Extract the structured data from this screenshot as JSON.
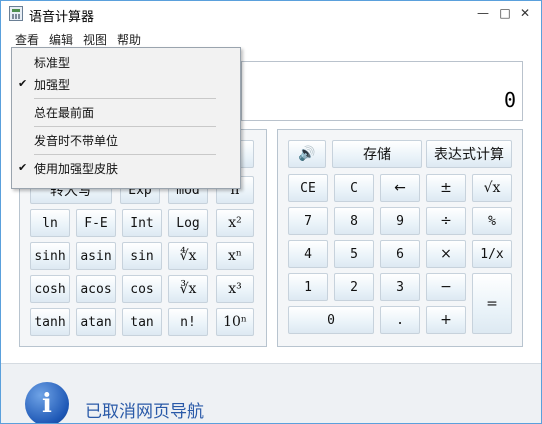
{
  "window": {
    "title": "语音计算器",
    "minimize": "—",
    "maximize": "□",
    "close": "✕"
  },
  "menubar": {
    "view": "查看",
    "edit": "编辑",
    "visual": "视图",
    "help": "帮助"
  },
  "display": {
    "value": "0"
  },
  "dropdown": {
    "items": [
      {
        "label": "标准型",
        "checked": false
      },
      {
        "label": "加强型",
        "checked": true
      },
      {
        "label": "总在最前面",
        "checked": false
      },
      {
        "label": "发音时不带单位",
        "checked": false
      },
      {
        "label": "使用加强型皮肤",
        "checked": true
      }
    ],
    "check_glyph": "✔"
  },
  "left_panel": {
    "row1": [
      "转大写",
      "Exp",
      "mod",
      "π"
    ],
    "row2": [
      "ln",
      "F-E",
      "Int",
      "Log",
      "x²"
    ],
    "row3": [
      "sinh",
      "asin",
      "sin",
      "∜x",
      "xⁿ"
    ],
    "row4": [
      "cosh",
      "acos",
      "cos",
      "∛x",
      "x³"
    ],
    "row5": [
      "tanh",
      "atan",
      "tan",
      "n!",
      "10ⁿ"
    ]
  },
  "right_panel": {
    "speaker_icon": "🔊",
    "store": "存储",
    "expression": "表达式计算",
    "row1": [
      "CE",
      "C",
      "←",
      "±",
      "√x"
    ],
    "row2": [
      "7",
      "8",
      "9",
      "÷",
      "%"
    ],
    "row3": [
      "4",
      "5",
      "6",
      "×",
      "1/x"
    ],
    "row4": [
      "1",
      "2",
      "3",
      "−"
    ],
    "row5": [
      "0",
      ".",
      "+"
    ],
    "equals": "="
  },
  "infobar": {
    "icon": "i",
    "text": "已取消网页导航"
  }
}
